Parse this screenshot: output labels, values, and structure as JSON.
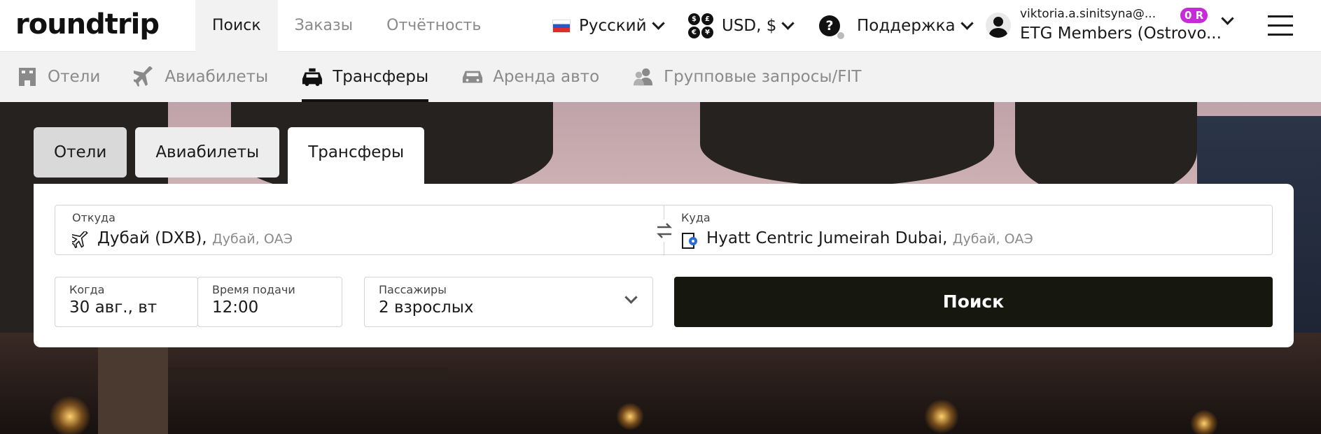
{
  "app": {
    "logo": "roundtrip"
  },
  "top_nav": [
    {
      "label": "Поиск",
      "active": true
    },
    {
      "label": "Заказы",
      "active": false
    },
    {
      "label": "Отчётность",
      "active": false
    }
  ],
  "toolbar": {
    "language": "Русский",
    "currency": "USD, $",
    "support": "Поддержка"
  },
  "user": {
    "email": "viktoria.a.sinitsyna@...",
    "org": "ETG Members (Ostrovo...",
    "balance_badge": "0 R",
    "badge_color": "#c72ad9"
  },
  "sub_nav": [
    {
      "label": "Отели",
      "icon": "hotel-icon",
      "active": false
    },
    {
      "label": "Авиабилеты",
      "icon": "plane-icon",
      "active": false
    },
    {
      "label": "Трансферы",
      "icon": "car-icon",
      "active": true
    },
    {
      "label": "Аренда авто",
      "icon": "car-rental-icon",
      "active": false
    },
    {
      "label": "Групповые запросы/FIT",
      "icon": "group-icon",
      "active": false
    }
  ],
  "search_tabs": [
    {
      "label": "Отели"
    },
    {
      "label": "Авиабилеты"
    },
    {
      "label": "Трансферы",
      "active": true
    }
  ],
  "form": {
    "from": {
      "label": "Откуда",
      "value": "Дубай (DXB),",
      "sub": "Дубай, ОАЭ",
      "icon": "plane-icon"
    },
    "to": {
      "label": "Куда",
      "value": "Hyatt Centric Jumeirah Dubai,",
      "sub": "Дубай, ОАЭ",
      "icon": "hotel-pin-icon"
    },
    "when": {
      "label": "Когда",
      "value": "30 авг., вт"
    },
    "time": {
      "label": "Время подачи",
      "value": "12:00"
    },
    "passengers": {
      "label": "Пассажиры",
      "value": "2 взрослых"
    },
    "search_label": "Поиск"
  },
  "colors": {
    "accent_dark": "#16170e",
    "nav_bg": "#f2f2f2"
  }
}
